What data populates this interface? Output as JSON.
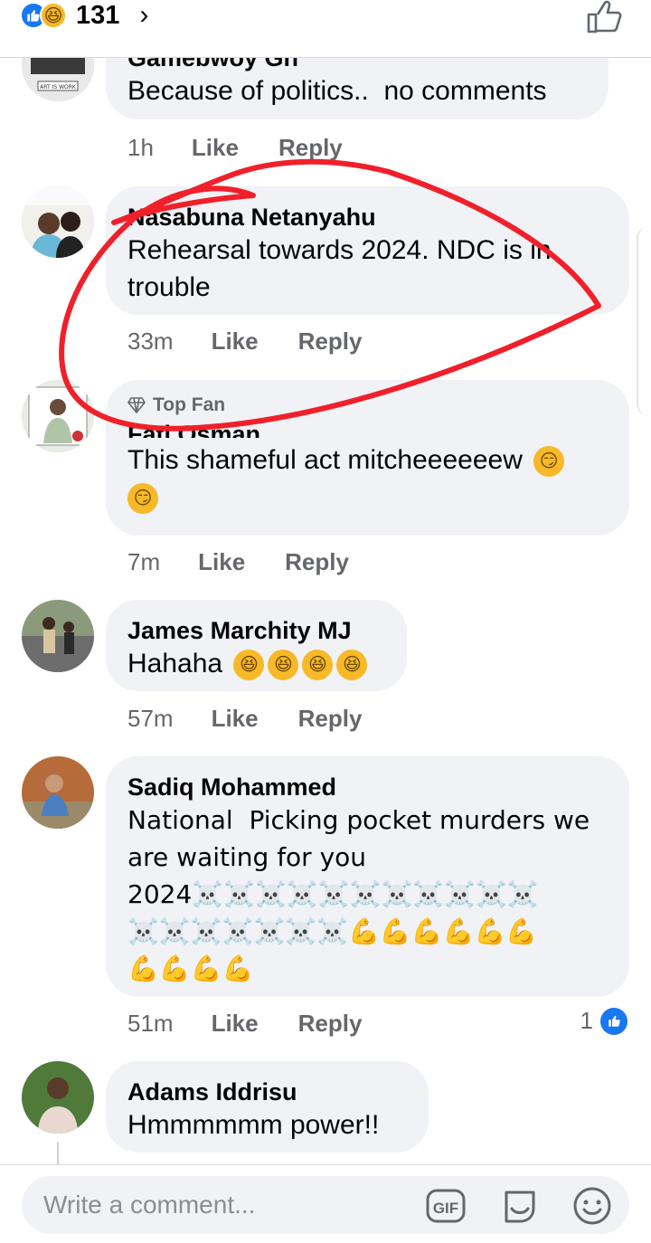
{
  "header": {
    "reaction_count": "131",
    "chevron": "›"
  },
  "comments": [
    {
      "name": "Gamebwoy Gh",
      "text": "Because of politics..  no comments",
      "time": "1h",
      "like": "Like",
      "reply": "Reply"
    },
    {
      "name": "Nasabuna Netanyahu",
      "text": "Rehearsal towards 2024. NDC is in\ntrouble",
      "time": "33m",
      "like": "Like",
      "reply": "Reply"
    },
    {
      "badge": "Top Fan",
      "name": "Fati Osman",
      "text": "This shameful act mitcheeeeeew",
      "time": "7m",
      "like": "Like",
      "reply": "Reply"
    },
    {
      "name": "James Marchity MJ",
      "text": "Hahaha",
      "time": "57m",
      "like": "Like",
      "reply": "Reply"
    },
    {
      "name": "Sadiq Mohammed",
      "text": "National  Picking pocket murders we\nare waiting for you\n2024☠️☠️☠️☠️☠️☠️☠️☠️☠️☠️☠️\n☠️☠️☠️☠️☠️☠️☠️💪💪💪💪💪💪\n💪💪💪💪",
      "time": "51m",
      "like": "Like",
      "reply": "Reply",
      "reaction_count": "1"
    },
    {
      "name": "Adams Iddrisu",
      "text": "Hmmmmmm power!!"
    }
  ],
  "composer": {
    "placeholder": "Write a comment...",
    "gif_label": "GIF"
  },
  "colors": {
    "like_blue": "#1877f2",
    "bubble_gray": "#f0f2f5",
    "annotation_red": "#f0202a"
  },
  "icons": [
    "like-icon",
    "haha-icon",
    "chevron-right-icon",
    "thumbs-up-outline-icon",
    "diamond-icon",
    "gif-icon",
    "sticker-icon",
    "smiley-icon"
  ]
}
